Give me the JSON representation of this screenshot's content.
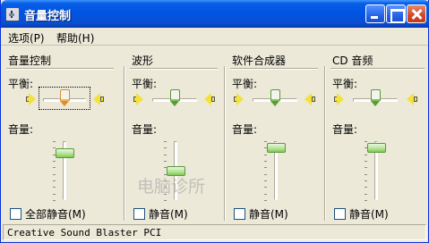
{
  "window": {
    "title": "音量控制"
  },
  "menu": {
    "items": [
      "选项(P)",
      "帮助(H)"
    ]
  },
  "columns": [
    {
      "title": "音量控制",
      "balance_label": "平衡:",
      "volume_label": "音量:",
      "mute_label": "全部静音(M)",
      "muted": false,
      "balance": 0.5,
      "volume": 0.8
    },
    {
      "title": "波形",
      "balance_label": "平衡:",
      "volume_label": "音量:",
      "mute_label": "静音(M)",
      "muted": false,
      "balance": 0.5,
      "volume": 0.5
    },
    {
      "title": "软件合成器",
      "balance_label": "平衡:",
      "volume_label": "音量:",
      "mute_label": "静音(M)",
      "muted": false,
      "balance": 0.5,
      "volume": 0.9
    },
    {
      "title": "CD 音频",
      "balance_label": "平衡:",
      "volume_label": "音量:",
      "mute_label": "静音(M)",
      "muted": false,
      "balance": 0.5,
      "volume": 0.9
    }
  ],
  "status_bar": {
    "text": "Creative Sound Blaster PCI"
  },
  "watermark": {
    "text": "电脑诊所"
  },
  "colors": {
    "titlebar": "#0054e3",
    "window_bg": "#ece9d8",
    "close_button": "#d1462a",
    "thumb_green": "#7ccb52",
    "thumb_orange": "#f6b45a",
    "speaker": "#f2e23a"
  }
}
